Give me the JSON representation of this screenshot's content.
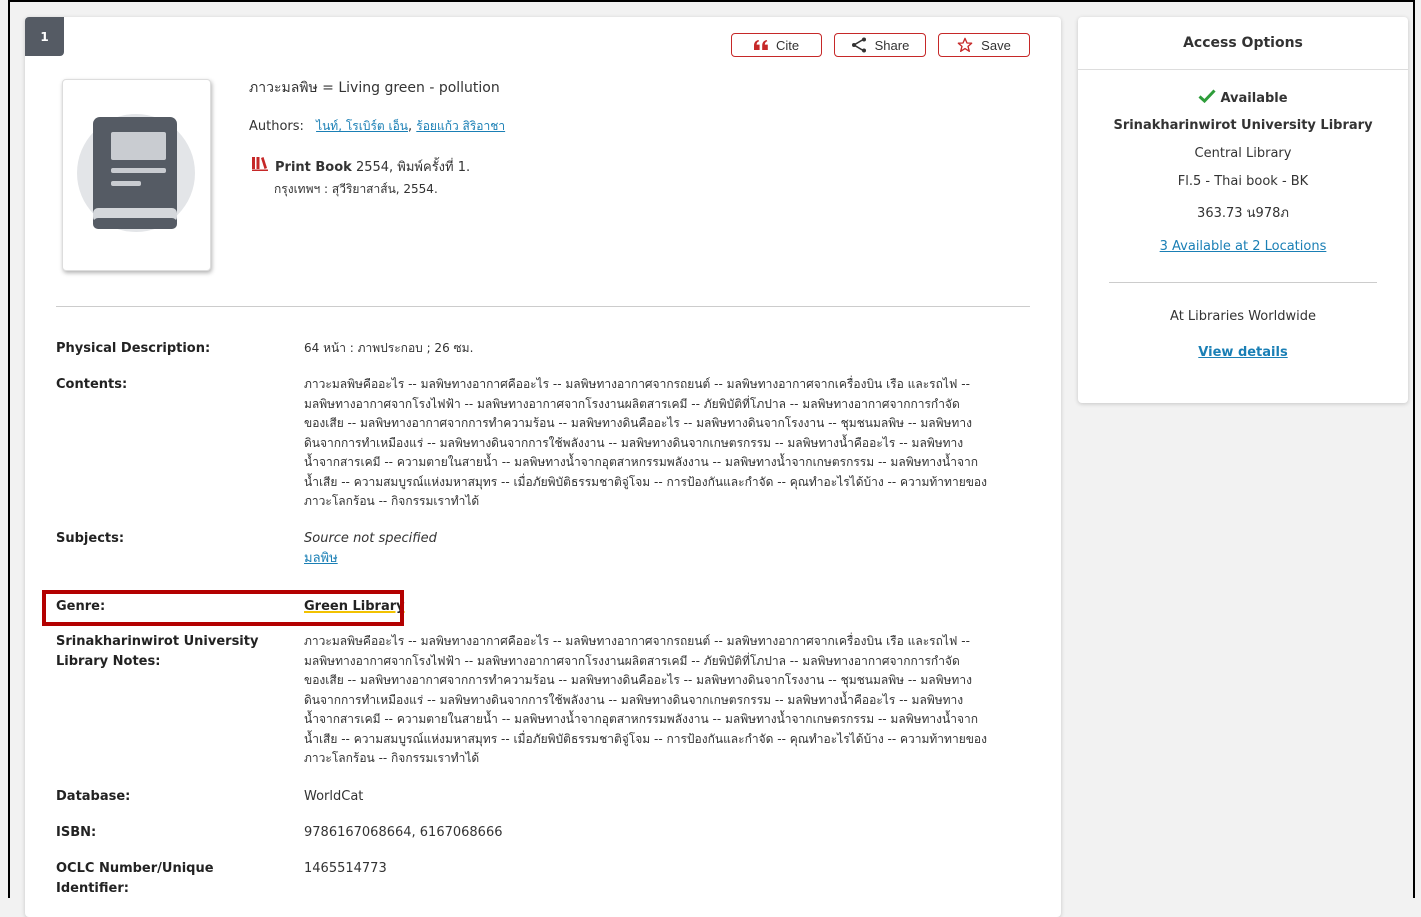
{
  "result_number": "1",
  "actions": {
    "cite": "Cite",
    "share": "Share",
    "save": "Save"
  },
  "colors": {
    "accent_red": "#c62828",
    "link": "#1a7fb5",
    "highlight_box": "#b30000",
    "available_green": "#2e9d3a"
  },
  "book": {
    "title": "ภาวะมลพิษ = Living green - pollution",
    "authors_label": "Authors:",
    "authors": [
      "ไนท์, โรเบิร์ต เอ็น",
      "ร้อยแก้ว สิริอาชา"
    ],
    "author_separator": ", ",
    "format_icon": "books-icon",
    "format_type": "Print Book",
    "format_detail": " 2554, พิมพ์ครั้งที่ 1.",
    "publisher": "กรุงเทพฯ : สุวีริยาสาส์น, 2554."
  },
  "details": {
    "physical_description": {
      "label": "Physical Description:",
      "value": "64 หน้า : ภาพประกอบ ; 26 ซม."
    },
    "contents": {
      "label": "Contents:",
      "lines": [
        "ภาวะมลพิษคืออะไร -- มลพิษทางอากาศคืออะไร -- มลพิษทางอากาศจากรถยนต์ -- มลพิษทางอากาศจากเครื่องบิน เรือ และรถไฟ --",
        "มลพิษทางอากาศจากโรงไฟฟ้า -- มลพิษทางอากาศจากโรงงานผลิตสารเคมี -- ภัยพิบัติที่โภปาล -- มลพิษทางอากาศจากการกำจัด",
        "ของเสีย -- มลพิษทางอากาศจากการทำความร้อน -- มลพิษทางดินคืออะไร -- มลพิษทางดินจากโรงงาน -- ชุมชนมลพิษ -- มลพิษทาง",
        "ดินจากการทำเหมืองแร่ -- มลพิษทางดินจากการใช้พลังงาน -- มลพิษทางดินจากเกษตรกรรม -- มลพิษทางน้ำคืออะไร -- มลพิษทาง",
        "น้ำจากสารเคมี -- ความตายในสายน้ำ -- มลพิษทางน้ำจากอุตสาหกรรมพลังงาน -- มลพิษทางน้ำจากเกษตรกรรม -- มลพิษทางน้ำจาก",
        "น้ำเสีย -- ความสมบูรณ์แห่งมหาสมุทร -- เมื่อภัยพิบัติธรรมชาติจู่โจม -- การป้องกันและกำจัด -- คุณทำอะไรได้บ้าง -- ความท้าทายของ",
        "ภาวะโลกร้อน -- กิจกรรมเราทำได้"
      ]
    },
    "subjects": {
      "label": "Subjects:",
      "source": "Source not specified",
      "link": "มลพิษ"
    },
    "genre": {
      "label": "Genre:",
      "value": "Green Library"
    },
    "notes": {
      "label": "Srinakharinwirot University Library Notes:",
      "lines": [
        "ภาวะมลพิษคืออะไร -- มลพิษทางอากาศคืออะไร -- มลพิษทางอากาศจากรถยนต์ -- มลพิษทางอากาศจากเครื่องบิน เรือ และรถไฟ --",
        "มลพิษทางอากาศจากโรงไฟฟ้า -- มลพิษทางอากาศจากโรงงานผลิตสารเคมี -- ภัยพิบัติที่โภปาล -- มลพิษทางอากาศจากการกำจัด",
        "ของเสีย -- มลพิษทางอากาศจากการทำความร้อน -- มลพิษทางดินคืออะไร -- มลพิษทางดินจากโรงงาน -- ชุมชนมลพิษ -- มลพิษทาง",
        "ดินจากการทำเหมืองแร่ -- มลพิษทางดินจากการใช้พลังงาน -- มลพิษทางดินจากเกษตรกรรม -- มลพิษทางน้ำคืออะไร -- มลพิษทาง",
        "น้ำจากสารเคมี -- ความตายในสายน้ำ -- มลพิษทางน้ำจากอุตสาหกรรมพลังงาน -- มลพิษทางน้ำจากเกษตรกรรม -- มลพิษทางน้ำจาก",
        "น้ำเสีย -- ความสมบูรณ์แห่งมหาสมุทร -- เมื่อภัยพิบัติธรรมชาติจู่โจม -- การป้องกันและกำจัด -- คุณทำอะไรได้บ้าง -- ความท้าทายของ",
        "ภาวะโลกร้อน -- กิจกรรมเราทำได้"
      ]
    },
    "database": {
      "label": "Database:",
      "value": "WorldCat"
    },
    "isbn": {
      "label": "ISBN:",
      "value": "9786167068664, 6167068666"
    },
    "oclc": {
      "label": "OCLC Number/Unique Identifier:",
      "value": "1465514773"
    }
  },
  "access": {
    "title": "Access Options",
    "status": "Available",
    "library": "Srinakharinwirot University Library",
    "branch": "Central Library",
    "shelf": "Fl.5 - Thai book - BK",
    "call_number": "363.73 น978ภ",
    "locations_link": "3 Available at 2 Locations",
    "worldwide_label": "At Libraries Worldwide",
    "view_details": "View details"
  }
}
